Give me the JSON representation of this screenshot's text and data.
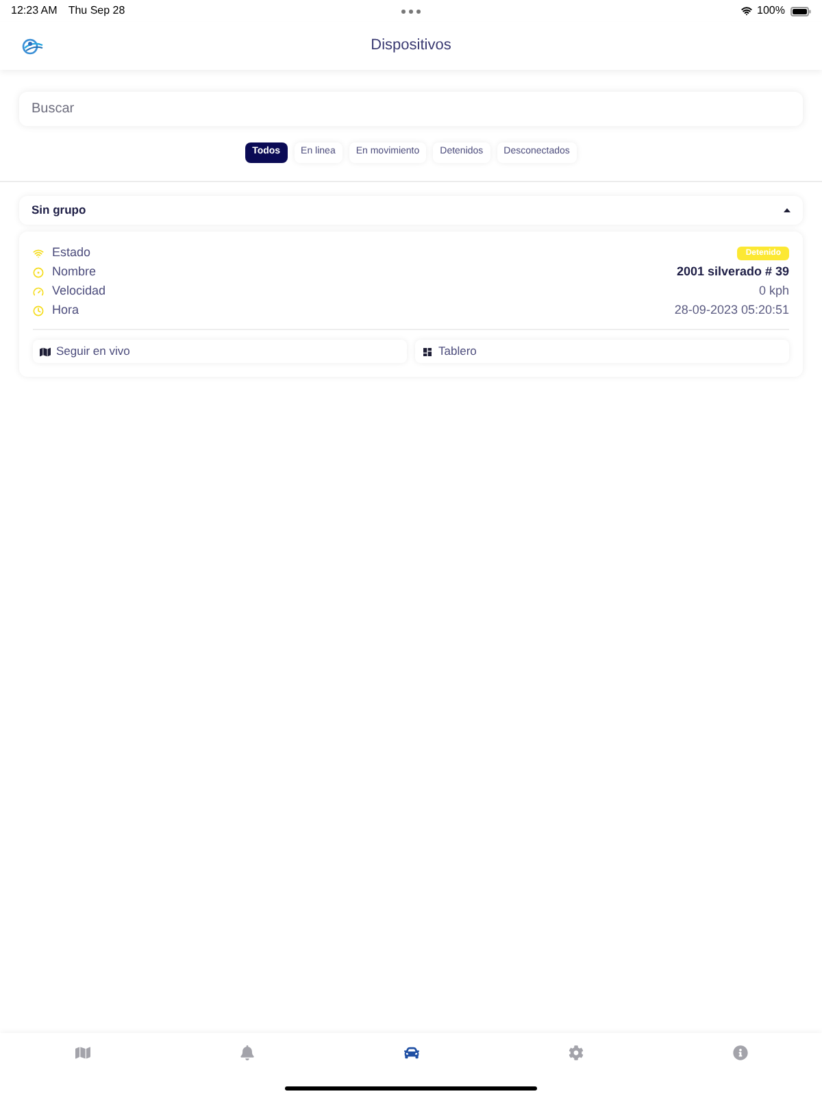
{
  "status_bar": {
    "time": "12:23 AM",
    "date": "Thu Sep 28",
    "battery": "100%"
  },
  "header": {
    "title": "Dispositivos"
  },
  "search": {
    "placeholder": "Buscar"
  },
  "filters": [
    {
      "label": "Todos",
      "selected": true
    },
    {
      "label": "En linea",
      "selected": false
    },
    {
      "label": "En movimiento",
      "selected": false
    },
    {
      "label": "Detenidos",
      "selected": false
    },
    {
      "label": "Desconectados",
      "selected": false
    }
  ],
  "groups": [
    {
      "name": "Sin grupo",
      "expanded": true,
      "devices": [
        {
          "fields": [
            {
              "kind": "badge",
              "label": "Estado",
              "value": "Detenido",
              "color": "#fce833"
            },
            {
              "kind": "title",
              "label": "Nombre",
              "value": "2001 silverado # 39"
            },
            {
              "kind": "text",
              "label": "Velocidad",
              "value": "0 kph"
            },
            {
              "kind": "text",
              "label": "Hora",
              "value": "28-09-2023 05:20:51"
            }
          ],
          "actions": [
            {
              "label": "Seguir en vivo"
            },
            {
              "label": "Tablero"
            }
          ]
        }
      ]
    }
  ],
  "tab_bar": [
    {
      "selected": false
    },
    {
      "selected": false
    },
    {
      "selected": true
    },
    {
      "selected": false
    },
    {
      "selected": false
    }
  ]
}
